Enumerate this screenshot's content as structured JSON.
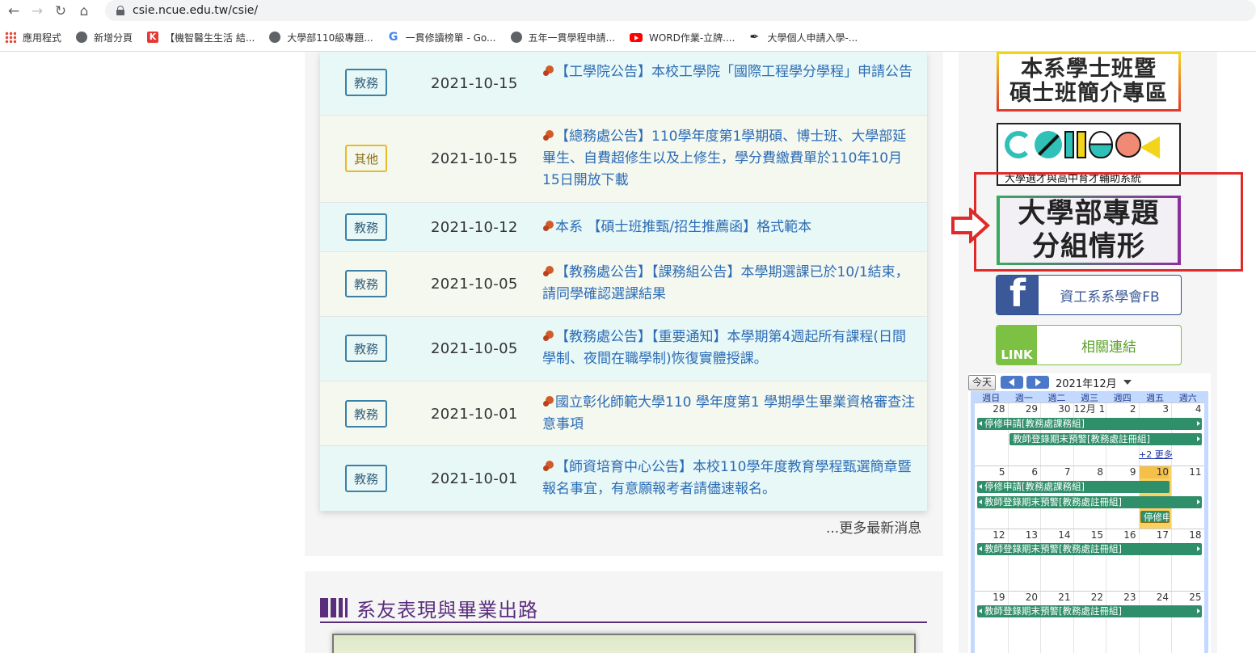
{
  "browser": {
    "url": "csie.ncue.edu.tw/csie/",
    "bookmarks": [
      {
        "icon": "apps-grid-icon",
        "label": "應用程式"
      },
      {
        "icon": "globe-icon",
        "label": "新增分頁"
      },
      {
        "icon": "k-logo-icon",
        "label": "【機智醫生生活 結..."
      },
      {
        "icon": "globe-icon",
        "label": "大學部110級專題..."
      },
      {
        "icon": "google-icon",
        "label": "一貫修讀榜單 - Go..."
      },
      {
        "icon": "globe-icon",
        "label": "五年一貫學程申請..."
      },
      {
        "icon": "youtube-icon",
        "label": "WORD作業-立牌...."
      },
      {
        "icon": "pen-icon",
        "label": "大學個人申請入學-..."
      }
    ]
  },
  "news": {
    "items": [
      {
        "tag": "教務",
        "date": "2021-10-15",
        "title": "【工學院公告】本校工學院「國際工程學分學程」申請公告"
      },
      {
        "tag": "其他",
        "date": "2021-10-15",
        "title": "【總務處公告】110學年度第1學期碩、博士班、大學部延畢生、自費超修生以及上修生，學分費繳費單於110年10月15日開放下載"
      },
      {
        "tag": "教務",
        "date": "2021-10-12",
        "title": "本系 【碩士班推甄/招生推薦函】格式範本"
      },
      {
        "tag": "教務",
        "date": "2021-10-05",
        "title": "【教務處公告】【課務組公告】本學期選課已於10/1結束，請同學確認選課結果"
      },
      {
        "tag": "教務",
        "date": "2021-10-05",
        "title": "【教務處公告】【重要通知】本學期第4週起所有課程(日間學制、夜間在職學制)恢復實體授課。"
      },
      {
        "tag": "教務",
        "date": "2021-10-01",
        "title": "國立彰化師範大學110 學年度第1 學期學生畢業資格審查注意事項"
      },
      {
        "tag": "教務",
        "date": "2021-10-01",
        "title": "【師資培育中心公告】本校110學年度教育學程甄選簡章暨報名事宜，有意願報考者請儘速報名。"
      }
    ],
    "more": "...更多最新消息"
  },
  "alumni": {
    "title": "系友表現與畢業出路"
  },
  "sidebar": {
    "banner1": {
      "line1": "本系學士班暨",
      "line2": "碩士班簡介專區"
    },
    "banner2": {
      "subtitle": "大學選才與高中育才輔助系統"
    },
    "banner3": {
      "line1": "大學部專題",
      "line2": "分組情形"
    },
    "fb": {
      "label": "資工系系學會FB"
    },
    "links": {
      "label": "相關連結",
      "icon_text": "LINK"
    }
  },
  "calendar": {
    "today": "今天",
    "month": "2021年12月",
    "dow": [
      "週日",
      "週一",
      "週二",
      "週三",
      "週四",
      "週五",
      "週六"
    ],
    "weeks": [
      {
        "days": [
          "28",
          "29",
          "30",
          "12月 1日",
          "2",
          "3",
          "4"
        ]
      },
      {
        "days": [
          "5",
          "6",
          "7",
          "8",
          "9",
          "10",
          "11"
        ]
      },
      {
        "days": [
          "12",
          "13",
          "14",
          "15",
          "16",
          "17",
          "18"
        ]
      },
      {
        "days": [
          "19",
          "20",
          "21",
          "22",
          "23",
          "24",
          "25"
        ]
      }
    ],
    "events": {
      "e1": "停修申請[教務處課務組]",
      "e2": "教師登錄期末預警[教務處註冊組]",
      "more1": "+2 更多",
      "e3": "停修申請[教務處課務組]",
      "e4": "教師登錄期末預警[教務處註冊組]",
      "e5": "停修申",
      "e6": "教師登錄期末預警[教務處註冊組]",
      "e7": "教師登錄期末預警[教務處註冊組]"
    },
    "today_color": "#fad163",
    "event_color": "#2f8f6a"
  }
}
